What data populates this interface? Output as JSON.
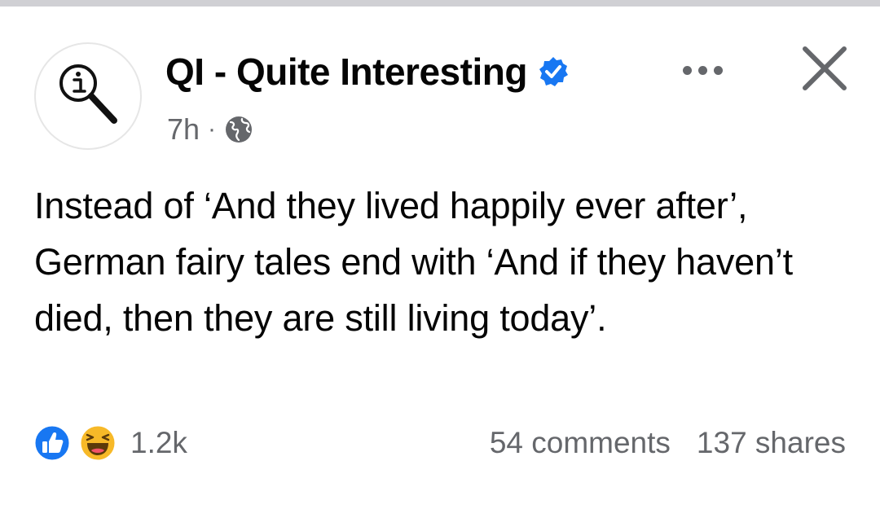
{
  "post": {
    "page_name": "QI - Quite Interesting",
    "timestamp": "7h",
    "separator": "·",
    "audience_icon": "globe-icon",
    "verified_icon": "verified-badge-icon",
    "avatar_icon": "magnifier-info-icon",
    "body": "Instead of ‘And they lived happily ever after’, German fairy tales end with ‘And if they haven’t died, then they are still living today’.",
    "reactions": {
      "icons": [
        "like-icon",
        "haha-icon"
      ],
      "count": "1.2k"
    },
    "comments": "54 comments",
    "shares": "137 shares"
  },
  "colors": {
    "verified_blue": "#1877f2",
    "like_blue": "#1877f2",
    "haha_yellow": "#f7b928",
    "secondary_text": "#65676b",
    "primary_text": "#050505"
  }
}
